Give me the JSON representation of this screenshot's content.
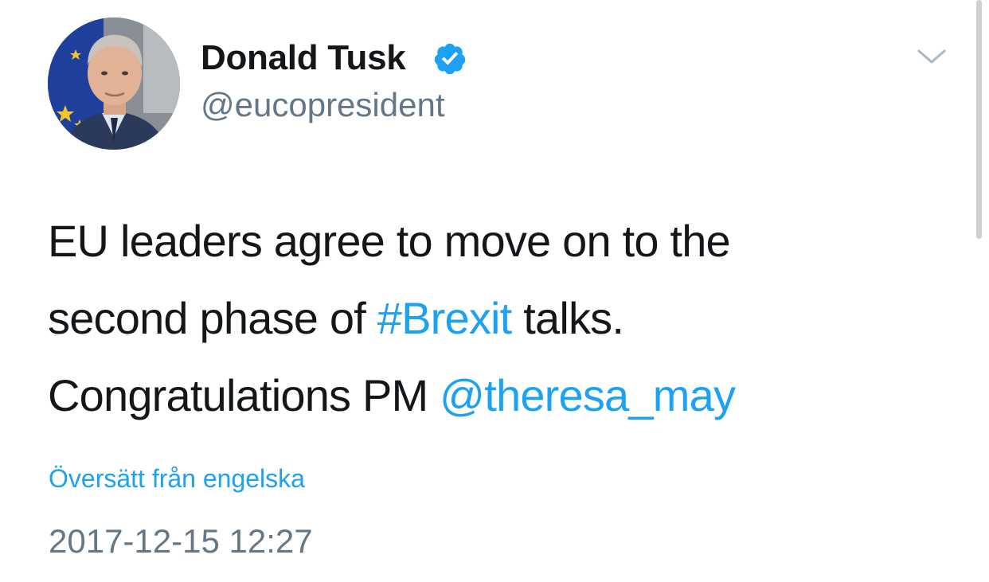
{
  "tweet": {
    "author": {
      "display_name": "Donald Tusk",
      "handle": "@eucopresident",
      "verified": true
    },
    "text_lines": [
      {
        "plain": "EU leaders agree to move on to the"
      },
      {
        "before": "second phase of ",
        "hashtag": "#Brexit",
        "after": " talks."
      },
      {
        "before": "Congratulations PM ",
        "mention": "@theresa_may"
      }
    ],
    "translate_label": "Översätt från engelska",
    "timestamp": "2017-12-15 12:27"
  },
  "colors": {
    "link": "#1da1f2",
    "text": "#14171a",
    "secondary": "#657786"
  },
  "icons": {
    "verified": "verified-badge-icon",
    "menu": "chevron-down-icon"
  }
}
